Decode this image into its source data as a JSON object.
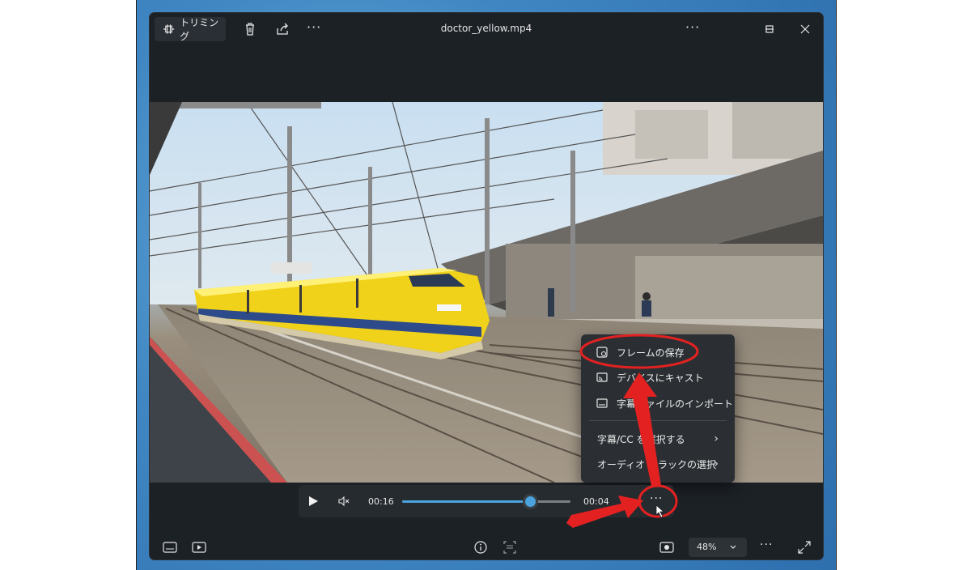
{
  "window": {
    "title": "doctor_yellow.mp4"
  },
  "toolbar": {
    "trim_label": "トリミング"
  },
  "context_menu": {
    "items": [
      {
        "label": "フレームの保存",
        "icon": "save-frame-icon"
      },
      {
        "label": "デバイスにキャスト",
        "icon": "cast-icon"
      },
      {
        "label": "字幕ファイルのインポート",
        "icon": "subtitles-icon"
      },
      {
        "label": "字幕/CC を選択する",
        "submenu": true
      },
      {
        "label": "オーディオ トラックの選択",
        "submenu": true
      }
    ]
  },
  "player": {
    "current_time": "00:16",
    "remaining_time": "00:04",
    "progress": 0.76
  },
  "bottom": {
    "zoom": "48%"
  },
  "colors": {
    "accent": "#4aa3df",
    "annotation": "#e32121"
  }
}
